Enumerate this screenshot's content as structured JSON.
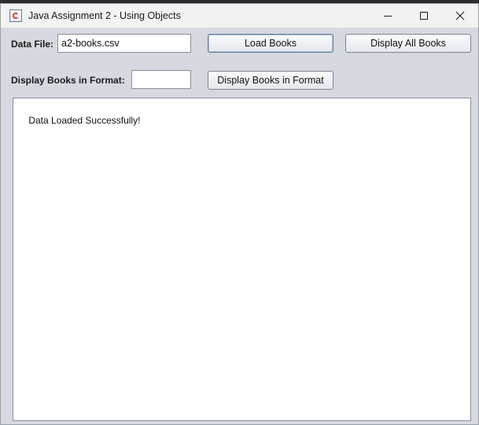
{
  "window": {
    "title": "Java Assignment 2 - Using Objects",
    "icon": "java-cup-icon",
    "controls": [
      "minimize-icon",
      "maximize-icon",
      "close-icon"
    ]
  },
  "form": {
    "data_file_label": "Data File:",
    "data_file_value": "a2-books.csv",
    "load_button": "Load Books",
    "display_all_button": "Display All Books",
    "format_label": "Display Books in Format:",
    "format_value": "",
    "display_format_button": "Display Books in Format"
  },
  "output": {
    "text": "Data Loaded Successfully!"
  }
}
